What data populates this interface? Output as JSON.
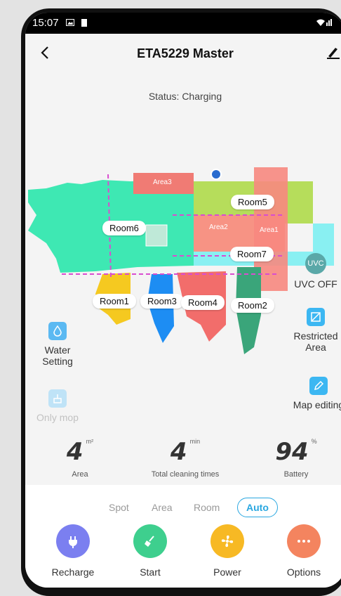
{
  "status_bar": {
    "time": "15:07"
  },
  "header": {
    "title": "ETA5229 Master"
  },
  "status": "Status: Charging",
  "map": {
    "areas": [
      "Area3",
      "Area2",
      "Area1"
    ],
    "rooms": [
      "Room5",
      "Room6",
      "Room7",
      "Room1",
      "Room3",
      "Room4",
      "Room2"
    ],
    "uvc_badge": "UVC"
  },
  "side": {
    "uvc": "UVC OFF",
    "restricted": "Restricted Area",
    "map_editing": "Map editing",
    "water": "Water Setting",
    "only_mop": "Only mop"
  },
  "stats": [
    {
      "value": "4",
      "unit": "m²",
      "label": "Area"
    },
    {
      "value": "4",
      "unit": "min",
      "label": "Total cleaning times"
    },
    {
      "value": "94",
      "unit": "%",
      "label": "Battery"
    }
  ],
  "modes": [
    "Spot",
    "Area",
    "Room",
    "Auto"
  ],
  "actions": [
    {
      "label": "Recharge",
      "color": "#7b7ff0"
    },
    {
      "label": "Start",
      "color": "#3ecf8e"
    },
    {
      "label": "Power",
      "color": "#f7b924"
    },
    {
      "label": "Options",
      "color": "#f4845f"
    }
  ]
}
